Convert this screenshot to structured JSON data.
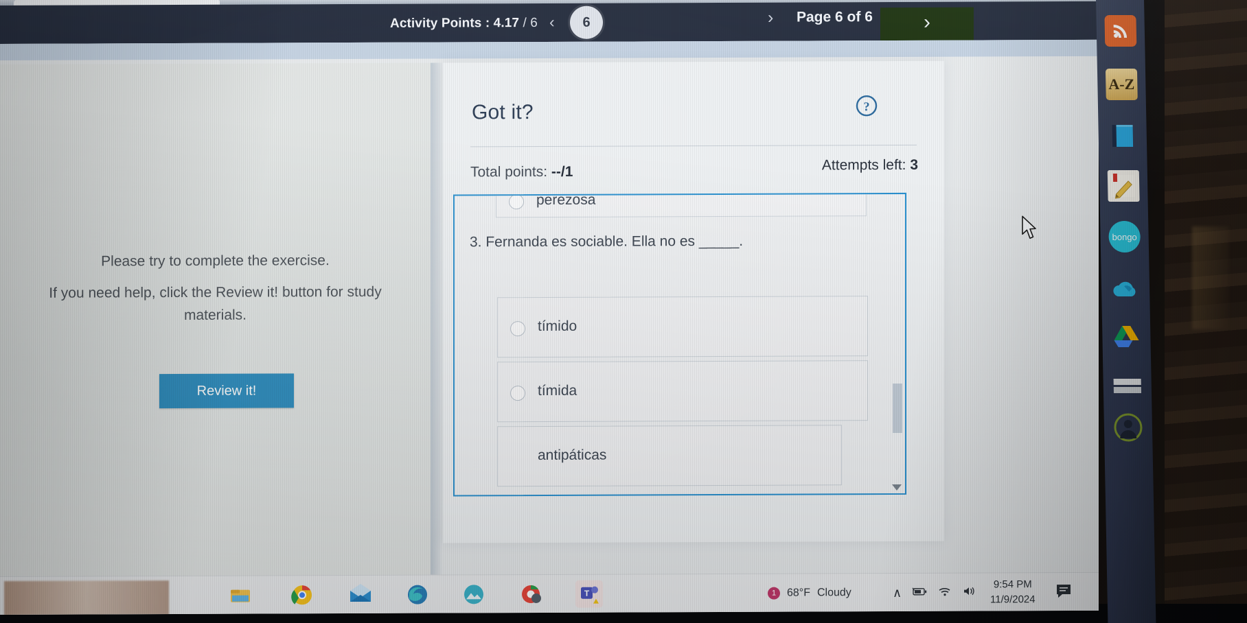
{
  "header": {
    "activity_points_label": "Activity Points : 4.17",
    "activity_points_denominator": "/ 6",
    "page_pill": "6",
    "page_label": "Page 6 of 6",
    "prev_chevron": "‹",
    "next_chevron_inline": "›",
    "next_page_chevron": "›",
    "accent_dark": "#242c3d",
    "next_button_color": "#1d3310"
  },
  "left_panel": {
    "message_line1": "Please try to complete the exercise.",
    "message_line2": "If you need help, click the Review it! button for study materials.",
    "review_button_label": "Review it!",
    "review_button_color": "#2e8dbe"
  },
  "card": {
    "title": "Got it?",
    "help_icon": "question-circle-icon",
    "total_points_prefix": "Total points: ",
    "total_points_value": "--/1",
    "attempts_prefix": "Attempts left: ",
    "attempts_value": "3",
    "focus_border_color": "#2990cf"
  },
  "question": {
    "previous_option_partial": "perezosa",
    "text": "3. Fernanda es sociable. Ella no es _____.",
    "options": [
      {
        "label": "tímido",
        "selected": false
      },
      {
        "label": "tímida",
        "selected": false
      },
      {
        "label": "antipáticas",
        "selected": false
      }
    ]
  },
  "taskbar": {
    "weather_temp": "68°F",
    "weather_condition": "Cloudy",
    "weather_badge": "1",
    "tray_chevron": "∧",
    "battery_icon": "battery-icon",
    "wifi_icon": "wifi-icon",
    "volume_icon": "volume-icon",
    "time": "9:54 PM",
    "date": "11/9/2024",
    "notification_icon": "notifications-icon",
    "apps": [
      "taskbar-item-art",
      "taskbar-item-file-explorer",
      "taskbar-item-chrome",
      "taskbar-item-mail",
      "taskbar-item-edge",
      "taskbar-item-photos",
      "taskbar-item-chrome-2",
      "taskbar-item-teams"
    ]
  },
  "side_dock": {
    "items": [
      {
        "name": "rss-icon",
        "label": ""
      },
      {
        "name": "a-z-icon",
        "label": "A-Z"
      },
      {
        "name": "book-icon",
        "label": ""
      },
      {
        "name": "note-pencil-icon",
        "label": ""
      },
      {
        "name": "bongo-icon",
        "label": "bongo"
      },
      {
        "name": "onedrive-cloud-icon",
        "label": ""
      },
      {
        "name": "google-drive-icon",
        "label": ""
      },
      {
        "name": "documents-icon",
        "label": ""
      },
      {
        "name": "user-avatar-icon",
        "label": ""
      }
    ]
  }
}
